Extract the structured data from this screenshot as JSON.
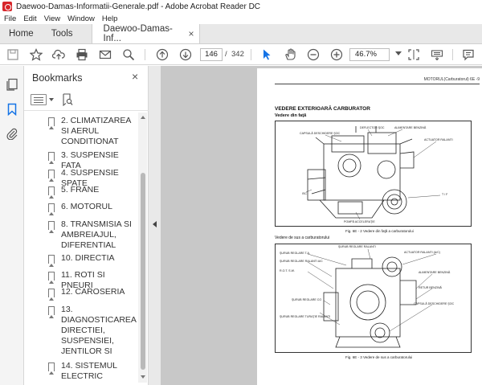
{
  "window": {
    "title": "Daewoo-Damas-Informatii-Generale.pdf - Adobe Acrobat Reader DC"
  },
  "menu": [
    "File",
    "Edit",
    "View",
    "Window",
    "Help"
  ],
  "tabs": {
    "home": "Home",
    "tools": "Tools",
    "document": "Daewoo-Damas-Inf...",
    "close": "×"
  },
  "toolbar": {
    "icons": [
      "save-icon",
      "star-icon",
      "upload-icon",
      "print-icon",
      "email-icon",
      "search-icon",
      "page-up-icon",
      "page-down-icon",
      "select-icon",
      "hand-icon",
      "zoom-out-icon",
      "zoom-in-icon",
      "fit-icon",
      "keyboard-icon",
      "comment-icon"
    ],
    "page_current": "146",
    "page_separator": "/",
    "page_total": "342",
    "zoom": "46.7%"
  },
  "bookmarks": {
    "title": "Bookmarks",
    "close": "×",
    "items": [
      "2. CLIMATIZAREA SI AERUL CONDITIONAT",
      "3. SUSPENSIE FATA",
      "4. SUSPENSIE SPATE",
      "5. FRANE",
      "6. MOTORUL",
      "8. TRANSMISIA SI AMBREIAJUL, DIFERENTIAL",
      "10. DIRECTIA",
      "11. ROTI SI PNEURI",
      "12. CAROSERIA",
      "13. DIAGNOSTICAREA DIRECTIEI, SUSPENSIEI, JENTILOR SI",
      "14. SISTEMUL ELECTRIC"
    ]
  },
  "document_page": {
    "running_header": "MOTORUL(Carburatorul) 6E -9",
    "section_title": "VEDERE EXTERIOARĂ CARBURATOR",
    "subtitle_front": "Vedere din faţă",
    "fig1_caption": "Fig. 6E - 2  Vedere din faţă a carburatorului",
    "subtitle_top": "Vedere de sus a carburatorului",
    "fig2_caption": "Fig. 6E - 3  Vedere de sus a carburatorului",
    "fig1_labels": [
      "CAPSULĂ DESCHIDERE ŞOC",
      "DEFLECTOR ŞOC",
      "ALIMENTARE BENZINĂ",
      "ACTUATOR RALANTI",
      "ISC",
      "T / F",
      "POMPĂ ACCELERAŢIE"
    ],
    "fig2_labels": [
      "ŞURUB REGLARE T.A.",
      "ŞURUB REGLARE RALANTI",
      "ŞURUB REGLARE RALANTI A/C",
      "ACTUATOR RALANTI (A/C)",
      "R.O.T. S.W.",
      "ALIMENTARE BENZINĂ",
      "ŞURUB REGLARE CO",
      "RETUR BENZINĂ",
      "ŞURUB REGLARE TURAŢIE RALANTI",
      "CAPSULĂ DESCHIDERE ŞOC"
    ]
  }
}
